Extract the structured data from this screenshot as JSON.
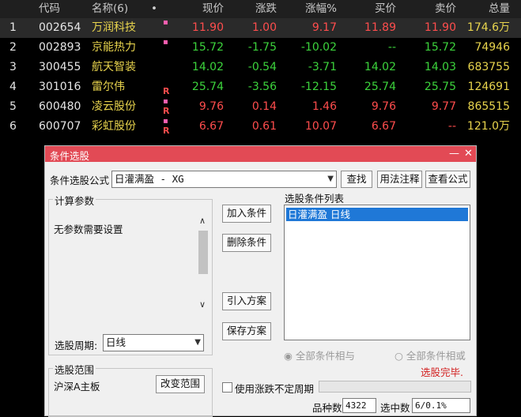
{
  "table": {
    "headers": {
      "code": "代码",
      "name": "名称(6)",
      "dot": "•",
      "price": "现价",
      "change": "涨跌",
      "pct": "涨幅%",
      "bid": "买价",
      "ask": "卖价",
      "volume": "总量"
    },
    "rows": [
      {
        "idx": "1",
        "code": "002654",
        "name": "万润科技",
        "mark": "▪",
        "flag": "",
        "price": "11.90",
        "change": "1.00",
        "pct": "9.17",
        "bid": "11.89",
        "ask": "11.90",
        "volume": "174.6万"
      },
      {
        "idx": "2",
        "code": "002893",
        "name": "京能热力",
        "mark": "▪",
        "flag": "",
        "price": "15.72",
        "change": "-1.75",
        "pct": "-10.02",
        "bid": "--",
        "ask": "15.72",
        "volume": "74946"
      },
      {
        "idx": "3",
        "code": "300455",
        "name": "航天智装",
        "mark": "",
        "flag": "",
        "price": "14.02",
        "change": "-0.54",
        "pct": "-3.71",
        "bid": "14.02",
        "ask": "14.03",
        "volume": "683755"
      },
      {
        "idx": "4",
        "code": "301016",
        "name": "雷尔伟",
        "mark": "",
        "flag": "R",
        "price": "25.74",
        "change": "-3.56",
        "pct": "-12.15",
        "bid": "25.74",
        "ask": "25.75",
        "volume": "124691"
      },
      {
        "idx": "5",
        "code": "600480",
        "name": "凌云股份",
        "mark": "▪",
        "flag": "R",
        "price": "9.76",
        "change": "0.14",
        "pct": "1.46",
        "bid": "9.76",
        "ask": "9.77",
        "volume": "865515"
      },
      {
        "idx": "6",
        "code": "600707",
        "name": "彩虹股份",
        "mark": "▪",
        "flag": "R",
        "price": "6.67",
        "change": "0.61",
        "pct": "10.07",
        "bid": "6.67",
        "ask": "--",
        "volume": "121.0万"
      }
    ]
  },
  "dialog": {
    "title": "条件选股",
    "min_btn": "—",
    "close_btn": "✕",
    "formula_label": "条件选股公式",
    "formula_value": "日灌满盈  -  XG",
    "btn_find": "查找",
    "btn_usage": "用法注释",
    "btn_view": "查看公式",
    "params_group": "计算参数",
    "params_text": "无参数需要设置",
    "btn_add": "加入条件",
    "btn_delete": "删除条件",
    "btn_load": "引入方案",
    "btn_save": "保存方案",
    "cond_list_label": "选股条件列表",
    "cond_list_items": [
      "日灌满盈   日线"
    ],
    "period_label": "选股周期:",
    "period_value": "日线",
    "radio_and": "全部条件相与",
    "radio_or": "全部条件相或",
    "status": "选股完毕.",
    "range_group": "选股范围",
    "range_value": "沪深A主板",
    "btn_range": "改变范围",
    "checkbox_label": "使用涨跌不定周期",
    "count_label": "品种数",
    "count_value": "4322",
    "selected_label": "选中数",
    "selected_value": "6/0.1%"
  }
}
